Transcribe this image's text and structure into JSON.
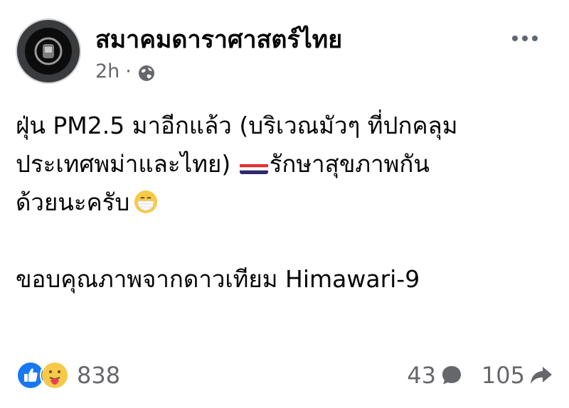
{
  "post": {
    "page_name": "สมาคมดาราศาสตร์ไทย",
    "time": "2h",
    "separator": "·",
    "privacy_icon": "globe-icon",
    "more_icon": "more-options-icon",
    "body": {
      "line1": "ฝุ่น PM2.5 มาอีกแล้ว (บริเวณมัวๆ ที่ปกคลุม",
      "line2a": "ประเทศพม่าและไทย) ",
      "line2b": "รักษาสุขภาพกัน",
      "line3": "ด้วยนะครับ",
      "line4": "ขอบคุณภาพจากดาวเทียม Himawari-9"
    },
    "reactions": {
      "icons": [
        "like-icon",
        "care-icon"
      ],
      "count": "838"
    },
    "comments": {
      "count": "43",
      "icon": "comment-icon"
    },
    "shares": {
      "count": "105",
      "icon": "share-icon"
    },
    "colors": {
      "like_blue": "#1877f2",
      "secondary_text": "#65676b",
      "primary_text": "#050505"
    }
  }
}
